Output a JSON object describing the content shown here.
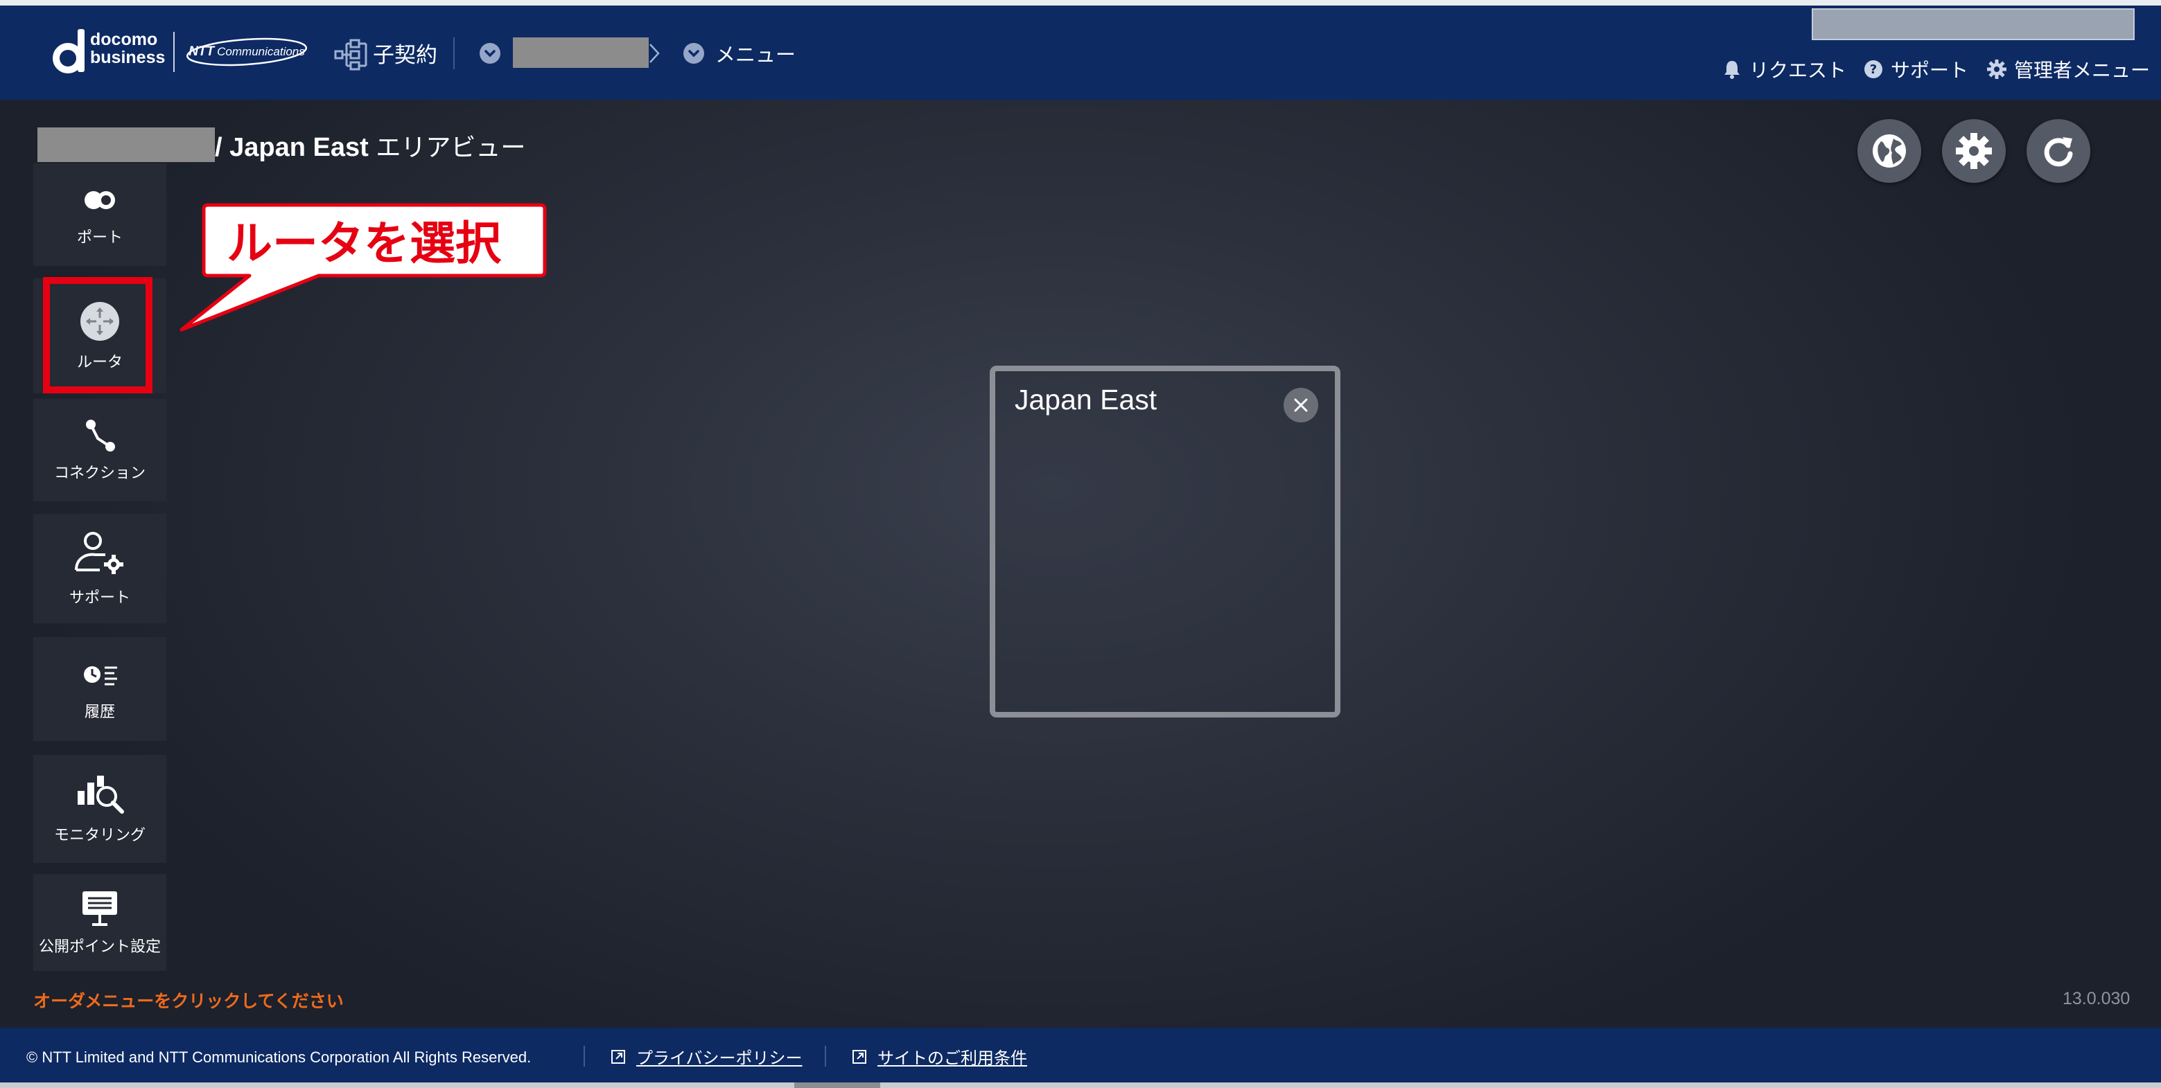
{
  "header": {
    "logo_line1": "docomo",
    "logo_line2": "business",
    "ntt_brand": "NTT",
    "ntt_sub": "Communications",
    "contract_label": "子契約",
    "menu_label": "メニュー",
    "nav": {
      "request": "リクエスト",
      "support": "サポート",
      "admin": "管理者メニュー"
    }
  },
  "main": {
    "title_suffix": "/ Japan East ",
    "title_suffix_jp": "エリアビュー",
    "sidebar": [
      {
        "label": "ポート",
        "icon": "port-icon"
      },
      {
        "label": "ルータ",
        "icon": "router-icon"
      },
      {
        "label": "コネクション",
        "icon": "connection-icon"
      },
      {
        "label": "サポート",
        "icon": "user-gear-icon"
      },
      {
        "label": "履歴",
        "icon": "history-icon"
      },
      {
        "label": "モニタリング",
        "icon": "monitoring-icon"
      },
      {
        "label": "公開ポイント設定",
        "icon": "public-point-icon"
      }
    ],
    "callout": "ルータを選択",
    "region": {
      "name": "Japan East"
    },
    "order_hint": "オーダメニューをクリックしてください",
    "version": "13.0.030"
  },
  "footer": {
    "copyright": "© NTT Limited and NTT Communications Corporation All Rights Reserved.",
    "privacy": "プライバシーポリシー",
    "terms": "サイトのご利用条件"
  },
  "colors": {
    "header_bg": "#0d2a63",
    "highlight": "#e60012",
    "hint": "#f06a1c"
  }
}
